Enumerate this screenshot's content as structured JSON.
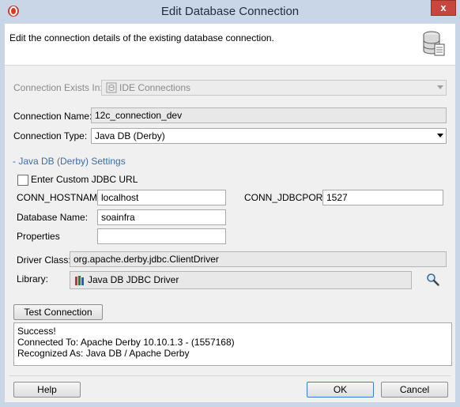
{
  "window": {
    "title": "Edit Database Connection",
    "close_glyph": "x"
  },
  "header": {
    "description": "Edit the connection details of the existing database connection."
  },
  "connection_exists_in": {
    "label": "Connection Exists In:",
    "value": "IDE Connections"
  },
  "connection_name": {
    "label": "Connection Name:",
    "value": "12c_connection_dev"
  },
  "connection_type": {
    "label": "Connection Type:",
    "value": "Java DB (Derby)"
  },
  "settings": {
    "section_title": "- Java DB (Derby) Settings",
    "custom_jdbc_label": "Enter Custom JDBC URL",
    "custom_jdbc_checked": false,
    "hostname_label": "CONN_HOSTNAME",
    "hostname_value": "localhost",
    "port_label": "CONN_JDBCPORT",
    "port_value": "1527",
    "database_label": "Database Name:",
    "database_value": "soainfra",
    "properties_label": "Properties",
    "properties_value": ""
  },
  "driver": {
    "label": "Driver Class:",
    "value": "org.apache.derby.jdbc.ClientDriver"
  },
  "library": {
    "label": "Library:",
    "value": "Java DB JDBC Driver"
  },
  "test_button": {
    "label": "Test Connection"
  },
  "output": {
    "lines": [
      "Success!",
      "Connected To: Apache Derby 10.10.1.3 - (1557168)",
      "Recognized As: Java DB / Apache Derby"
    ]
  },
  "buttons": {
    "help": "Help",
    "ok": "OK",
    "cancel": "Cancel"
  },
  "colors": {
    "title_bar": "#c9d6e8",
    "close_button": "#c7463d",
    "section_title": "#3c6ea8"
  }
}
